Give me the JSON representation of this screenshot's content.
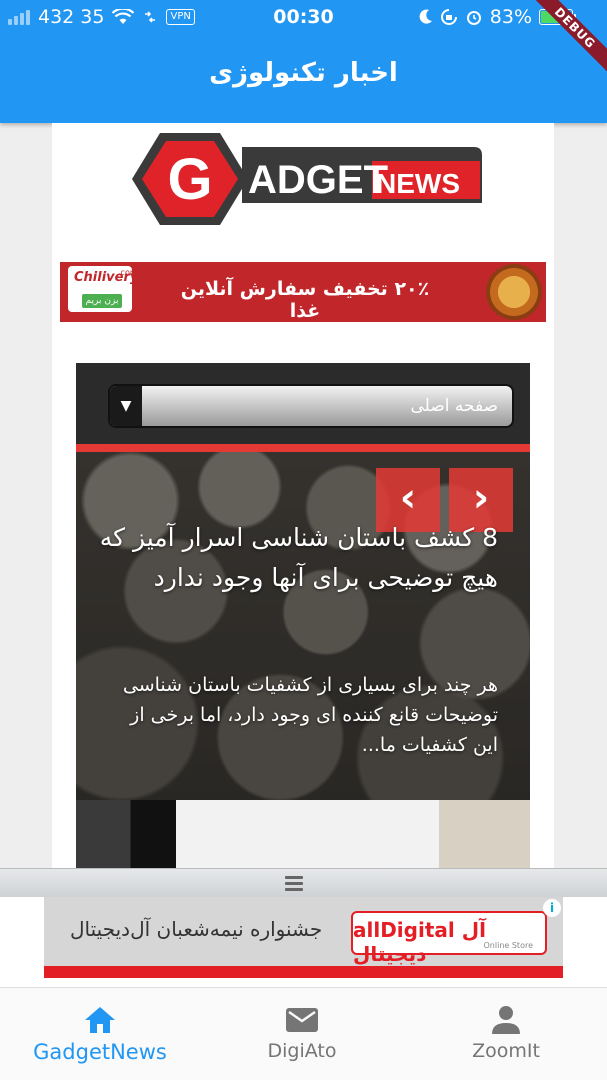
{
  "status_bar": {
    "left_text": "432 35",
    "vpn_label": "VPN",
    "time": "00:30",
    "battery_text": "83%",
    "battery_level": 0.83
  },
  "app_bar": {
    "title": "اخبار تکنولوژی",
    "debug_banner": "DEBUG"
  },
  "header_logo": {
    "letter": "G",
    "word": "ADGET",
    "suffix": "NEWS"
  },
  "ad_banner_top": {
    "brand": "Chilivery",
    "brand_domain": ".com",
    "cta": "بزن بریم",
    "promo_text": "۲۰٪ تخفیف سفارش آنلاین غذا"
  },
  "category_dropdown": {
    "selected": "صفحه اصلی"
  },
  "slider": {
    "prev_icon": "‹",
    "next_icon": "›",
    "article": {
      "title": "8 کشف باستان شناسی اسرار آمیز که هیچ توضیحی برای آنها وجود ندارد",
      "excerpt": "هر چند برای بسیاری از کشفیات باستان شناسی توضیحات قانع کننده ای وجود دارد، اما برخی از این کشفیات ما..."
    }
  },
  "ad_banner_bottom": {
    "text": "جشنواره نیمه‌شعبان آل‌دیجیتال",
    "logo_text": "allDigital آل دیجیتال",
    "logo_sub": "Online Store",
    "info_icon": "i"
  },
  "bottom_nav": {
    "active_index": 0,
    "tabs": [
      {
        "label": "GadgetNews",
        "icon": "home-icon"
      },
      {
        "label": "DigiAto",
        "icon": "mail-icon"
      },
      {
        "label": "ZoomIt",
        "icon": "person-icon"
      }
    ]
  },
  "colors": {
    "primary": "#2196f3",
    "accent_red": "#e53935",
    "inactive": "#757575"
  }
}
